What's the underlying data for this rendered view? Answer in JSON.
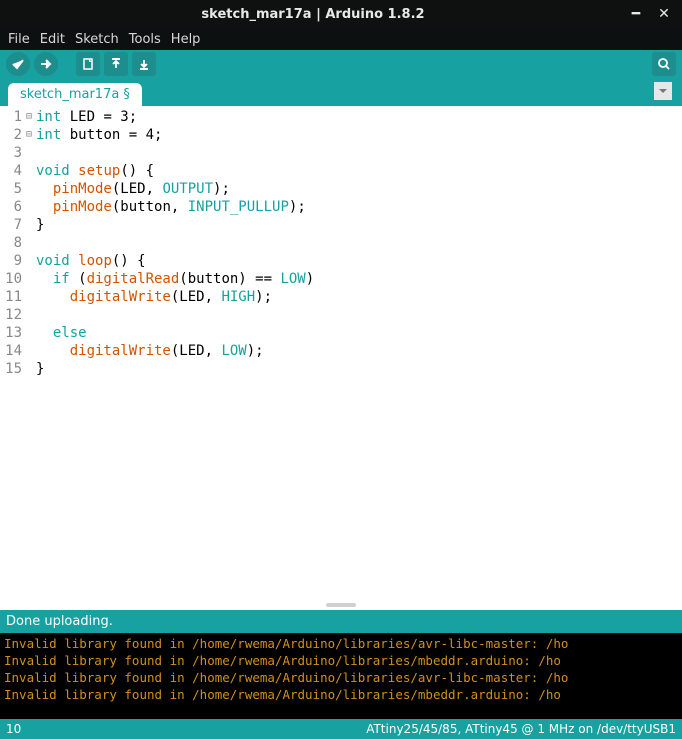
{
  "window": {
    "title": "sketch_mar17a | Arduino 1.8.2"
  },
  "menu": {
    "items": [
      "File",
      "Edit",
      "Sketch",
      "Tools",
      "Help"
    ]
  },
  "tab": {
    "name": "sketch_mar17a",
    "modified_marker": "§"
  },
  "code": {
    "lines": [
      {
        "n": 1,
        "seg": [
          {
            "c": "kw",
            "t": "int"
          },
          {
            "t": " LED = 3;"
          }
        ]
      },
      {
        "n": 2,
        "seg": [
          {
            "c": "kw",
            "t": "int"
          },
          {
            "t": " button = 4;"
          }
        ]
      },
      {
        "n": 3,
        "seg": [
          {
            "t": ""
          }
        ]
      },
      {
        "n": 4,
        "fold": "⊟",
        "seg": [
          {
            "c": "kw",
            "t": "void"
          },
          {
            "t": " "
          },
          {
            "c": "fn",
            "t": "setup"
          },
          {
            "t": "() {"
          }
        ]
      },
      {
        "n": 5,
        "seg": [
          {
            "t": "  "
          },
          {
            "c": "fn",
            "t": "pinMode"
          },
          {
            "t": "(LED, "
          },
          {
            "c": "cst",
            "t": "OUTPUT"
          },
          {
            "t": ");"
          }
        ]
      },
      {
        "n": 6,
        "seg": [
          {
            "t": "  "
          },
          {
            "c": "fn",
            "t": "pinMode"
          },
          {
            "t": "(button, "
          },
          {
            "c": "cst",
            "t": "INPUT_PULLUP"
          },
          {
            "t": ");"
          }
        ]
      },
      {
        "n": 7,
        "seg": [
          {
            "t": "}"
          }
        ]
      },
      {
        "n": 8,
        "seg": [
          {
            "t": ""
          }
        ]
      },
      {
        "n": 9,
        "fold": "⊟",
        "seg": [
          {
            "c": "kw",
            "t": "void"
          },
          {
            "t": " "
          },
          {
            "c": "fn",
            "t": "loop"
          },
          {
            "t": "() {"
          }
        ]
      },
      {
        "n": 10,
        "seg": [
          {
            "t": "  "
          },
          {
            "c": "kw",
            "t": "if"
          },
          {
            "t": " ("
          },
          {
            "c": "fn",
            "t": "digitalRead"
          },
          {
            "t": "(button) == "
          },
          {
            "c": "cst",
            "t": "LOW"
          },
          {
            "t": ")"
          }
        ]
      },
      {
        "n": 11,
        "seg": [
          {
            "t": "    "
          },
          {
            "c": "fn",
            "t": "digitalWrite"
          },
          {
            "t": "(LED, "
          },
          {
            "c": "cst",
            "t": "HIGH"
          },
          {
            "t": ");"
          }
        ]
      },
      {
        "n": 12,
        "seg": [
          {
            "t": ""
          }
        ]
      },
      {
        "n": 13,
        "seg": [
          {
            "t": "  "
          },
          {
            "c": "kw",
            "t": "else"
          }
        ]
      },
      {
        "n": 14,
        "seg": [
          {
            "t": "    "
          },
          {
            "c": "fn",
            "t": "digitalWrite"
          },
          {
            "t": "(LED, "
          },
          {
            "c": "cst",
            "t": "LOW"
          },
          {
            "t": ");"
          }
        ]
      },
      {
        "n": 15,
        "seg": [
          {
            "t": "}"
          }
        ]
      }
    ]
  },
  "status": {
    "upload": "Done uploading."
  },
  "console": {
    "lines": [
      "Invalid library found in /home/rwema/Arduino/libraries/avr-libc-master: /ho",
      "Invalid library found in /home/rwema/Arduino/libraries/mbeddr.arduino: /ho",
      "Invalid library found in /home/rwema/Arduino/libraries/avr-libc-master: /ho",
      "Invalid library found in /home/rwema/Arduino/libraries/mbeddr.arduino: /ho"
    ]
  },
  "bottom": {
    "line_number": "10",
    "board_info": "ATtiny25/45/85, ATtiny45 @ 1 MHz on /dev/ttyUSB1"
  }
}
